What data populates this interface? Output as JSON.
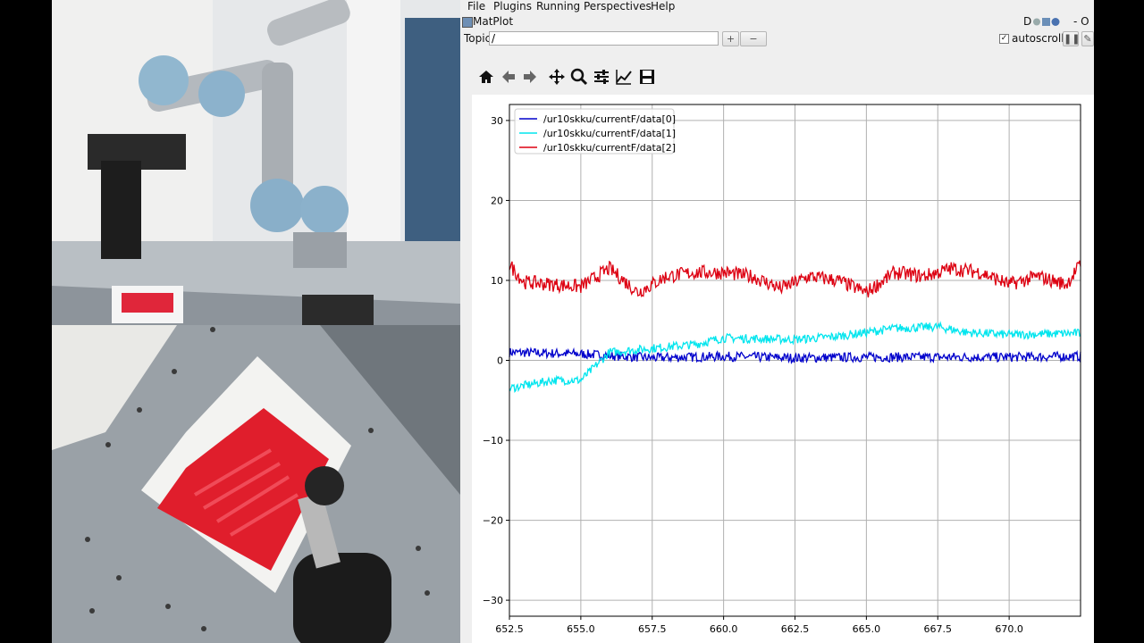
{
  "menu": {
    "items": [
      {
        "label": "File"
      },
      {
        "label": "Plugins"
      },
      {
        "label": "Running"
      },
      {
        "label": "Perspectives"
      },
      {
        "label": "Help"
      }
    ]
  },
  "window": {
    "title": "MatPlot",
    "corner_flags": "D",
    "corner_controls": "- O"
  },
  "topic": {
    "label": "Topic",
    "value": "/",
    "add_button": "+",
    "remove_button": "−",
    "autoscroll_label": "autoscroll",
    "autoscroll_checked": true
  },
  "toolbar": {
    "icons": [
      "home-icon",
      "back-arrow-icon",
      "forward-arrow-icon",
      "pan-icon",
      "zoom-icon",
      "configure-subplots-icon",
      "edit-axis-icon",
      "save-icon"
    ]
  },
  "colors": {
    "series0": "#0000cc",
    "series1": "#00e5ee",
    "series2": "#dd0011"
  },
  "chart_data": {
    "type": "line",
    "xlim": [
      652.5,
      672.5
    ],
    "ylim": [
      -32,
      32
    ],
    "x_ticks": [
      "652.5",
      "655.0",
      "657.5",
      "660.0",
      "662.5",
      "665.0",
      "667.5",
      "670.0"
    ],
    "y_ticks": [
      "30",
      "20",
      "10",
      "0",
      "−10",
      "−20",
      "−30"
    ],
    "grid": true,
    "legend_position": "top-left",
    "series": [
      {
        "name": "/ur10skku/currentF/data[0]",
        "x": [
          652.5,
          655,
          657.5,
          660,
          662.5,
          665,
          667.5,
          670,
          672.5
        ],
        "values": [
          1.0,
          0.8,
          0.3,
          0.5,
          0.3,
          0.4,
          0.4,
          0.4,
          0.5
        ]
      },
      {
        "name": "/ur10skku/currentF/data[1]",
        "x": [
          652.5,
          654,
          655,
          656,
          657.5,
          659,
          660,
          662.5,
          664,
          665,
          666,
          667.5,
          668.5,
          670,
          672.5
        ],
        "values": [
          -3.5,
          -2.5,
          -2.5,
          1.0,
          1.5,
          2.0,
          2.8,
          2.6,
          3.0,
          3.5,
          4.0,
          4.2,
          3.5,
          3.2,
          3.4
        ]
      },
      {
        "name": "/ur10skku/currentF/data[2]",
        "x": [
          652.5,
          653,
          654,
          655,
          656,
          657,
          658,
          659,
          660,
          661,
          662,
          663,
          664,
          665,
          666,
          667,
          668,
          669,
          670,
          671,
          672,
          672.5
        ],
        "values": [
          12.0,
          9.8,
          9.5,
          9.2,
          11.5,
          8.5,
          10.5,
          11.0,
          11.0,
          10.5,
          9.0,
          10.5,
          10.0,
          8.5,
          11.0,
          10.5,
          11.5,
          11.0,
          9.5,
          10.5,
          9.5,
          12.0
        ]
      }
    ]
  }
}
